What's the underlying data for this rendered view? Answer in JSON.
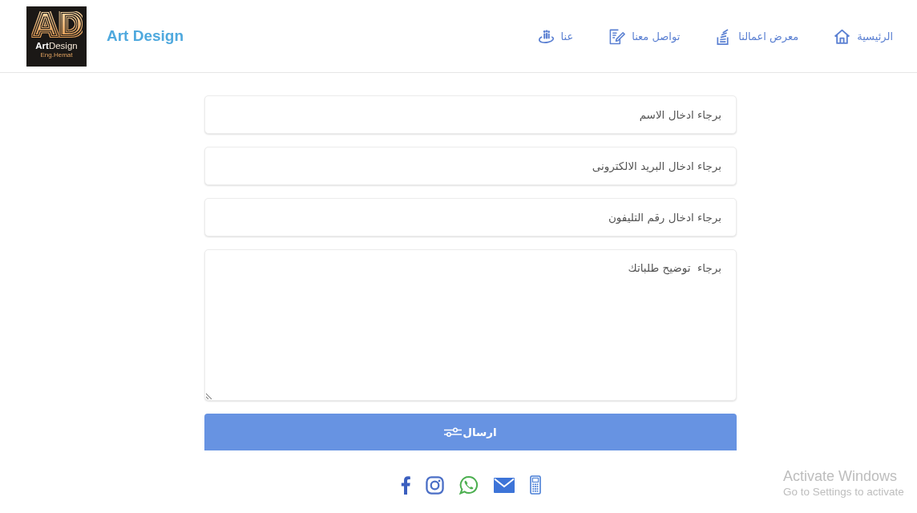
{
  "header": {
    "logo": {
      "monogram": "AD",
      "wordmark": "**Art**Design",
      "tagline": "Eng.Hemat"
    },
    "brand": "Art Design",
    "nav": [
      {
        "label": "الرئيسية"
      },
      {
        "label": "معرض اعمالنا"
      },
      {
        "label": "تواصل معنا"
      },
      {
        "label": "عنا"
      }
    ]
  },
  "form": {
    "fields": [
      {
        "kind": "input",
        "placeholder": "برجاء ادخال الاسم"
      },
      {
        "kind": "input",
        "placeholder": "برجاء ادخال البريد الالكترونى"
      },
      {
        "kind": "input",
        "placeholder": "برجاء ادخال رقم التليفون"
      },
      {
        "kind": "textarea",
        "placeholder": "برجاء  توضيح طلباتك"
      }
    ],
    "submit": {
      "label": "ارسال"
    }
  },
  "os_overlay": {
    "title": "Activate Windows",
    "message": "Go to Settings to activate"
  }
}
